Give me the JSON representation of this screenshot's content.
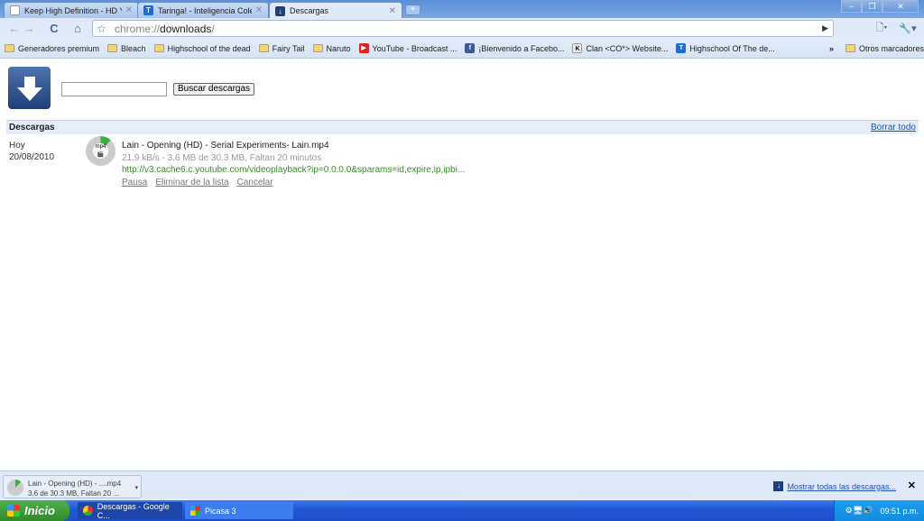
{
  "tabs": [
    {
      "label": "Keep High Definition - HD Y...",
      "icon": "page-icon"
    },
    {
      "label": "Taringa! - Inteligencia Cole...",
      "icon": "taringa-icon"
    },
    {
      "label": "Descargas",
      "icon": "download-icon",
      "active": true
    }
  ],
  "omnibox": {
    "scheme": "chrome://",
    "host": "downloads",
    "path": "/"
  },
  "bookmarks": [
    {
      "label": "Generadores premium",
      "icon": "folder"
    },
    {
      "label": "Bleach",
      "icon": "folder"
    },
    {
      "label": "Highschool of the dead",
      "icon": "folder"
    },
    {
      "label": "Fairy Tail",
      "icon": "folder"
    },
    {
      "label": "Naruto",
      "icon": "folder"
    },
    {
      "label": "YouTube - Broadcast ...",
      "icon": "youtube"
    },
    {
      "label": "¡Bienvenido a Facebo...",
      "icon": "facebook"
    },
    {
      "label": "Clan <CO*> Website...",
      "icon": "clan"
    },
    {
      "label": "Highschool Of The de...",
      "icon": "taringa"
    }
  ],
  "other_bookmarks": "Otros marcadores",
  "search": {
    "value": "",
    "button": "Buscar descargas"
  },
  "section": {
    "title": "Descargas",
    "clear_all": "Borrar todo"
  },
  "download": {
    "day": "Hoy",
    "date": "20/08/2010",
    "name": "Lain - Opening (HD) - Serial Experiments- Lain.mp4",
    "progress_text": "21.9 kB/s - 3.6 MB de 30.3 MB, Faltan 20 minutos",
    "progress_fraction": 0.12,
    "url": "http://v3.cache6.c.youtube.com/videoplayback?ip=0.0.0.0&sparams=id,expire,ip,ipbi...",
    "actions": [
      "Pausa",
      "Eliminar de la lista",
      "Cancelar"
    ],
    "file_type": "mp4"
  },
  "shelf": {
    "item_name": "Lain - Opening (HD) - ....mp4",
    "item_status": "3.6 de 30.3 MB, Faltan 20 ...",
    "show_all": "Mostrar todas las descargas..."
  },
  "taskbar": {
    "start": "Inicio",
    "tasks": [
      "Descargas - Google C...",
      "Picasa 3"
    ],
    "clock": "09:51 p.m."
  }
}
